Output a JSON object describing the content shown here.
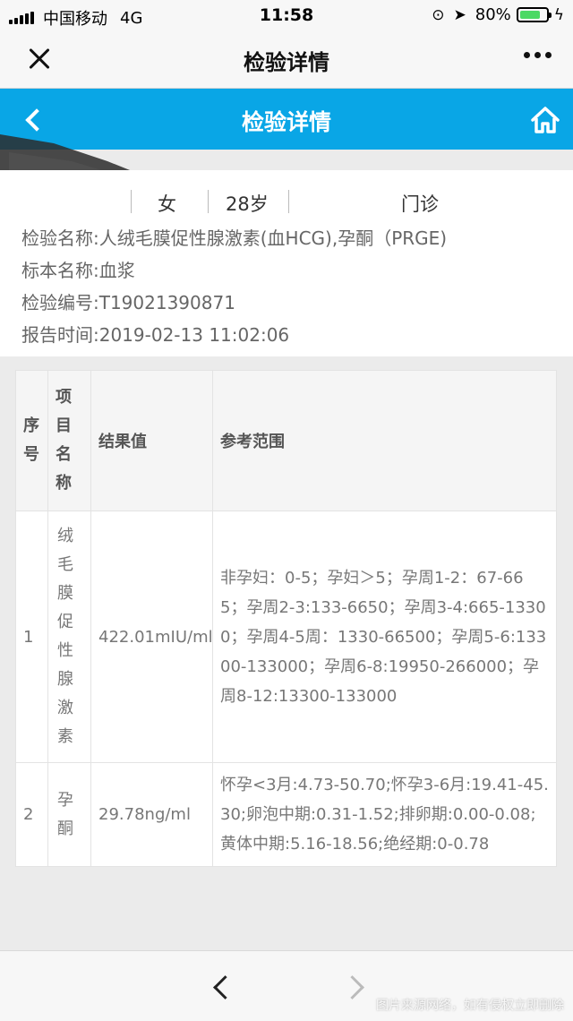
{
  "status_bar": {
    "carrier": "中国移动",
    "network": "4G",
    "time": "11:58",
    "battery": "80%",
    "battery_level": 0.8
  },
  "wechat_bar": {
    "title": "检验详情"
  },
  "header": {
    "title": "检验详情",
    "accent_color": "#09a6e6"
  },
  "patient": {
    "gender": "女",
    "age": "28岁",
    "department": "门诊"
  },
  "details": {
    "test_name": "检验名称:人绒毛膜促性腺激素(血HCG),孕酮（PRGE)",
    "specimen": "标本名称:血浆",
    "test_number": "检验编号:T19021390871",
    "report_time": "报告时间:2019-02-13 11:02:06"
  },
  "table": {
    "headers": [
      "序号",
      "项目名称",
      "结果值",
      "参考范围"
    ],
    "rows": [
      {
        "seq": "1",
        "name": "绒毛膜促性腺激素",
        "result": "422.01mIU/ml",
        "range": "非孕妇：0-5；孕妇＞5；孕周1-2：67-665；孕周2-3:133-6650；孕周3-4:665-13300；孕周4-5周：1330-66500；孕周5-6:13300-133000；孕周6-8:19950-266000；孕周8-12:13300-133000"
      },
      {
        "seq": "2",
        "name": "孕酮",
        "result": "29.78ng/ml",
        "range": "怀孕<3月:4.73-50.70;怀孕3-6月:19.41-45.30;卵泡中期:0.31-1.52;排卵期:0.00-0.08;黄体中期:5.16-18.56;绝经期:0-0.78"
      }
    ]
  },
  "bottom_bar": {
    "watermark": "图片来源网络，如有侵权立即删除"
  },
  "icons": {
    "close": "close-icon",
    "more": "more-icon",
    "back": "back-arrow-icon",
    "home": "home-icon",
    "prev": "chevron-left-icon",
    "next": "chevron-right-icon"
  }
}
